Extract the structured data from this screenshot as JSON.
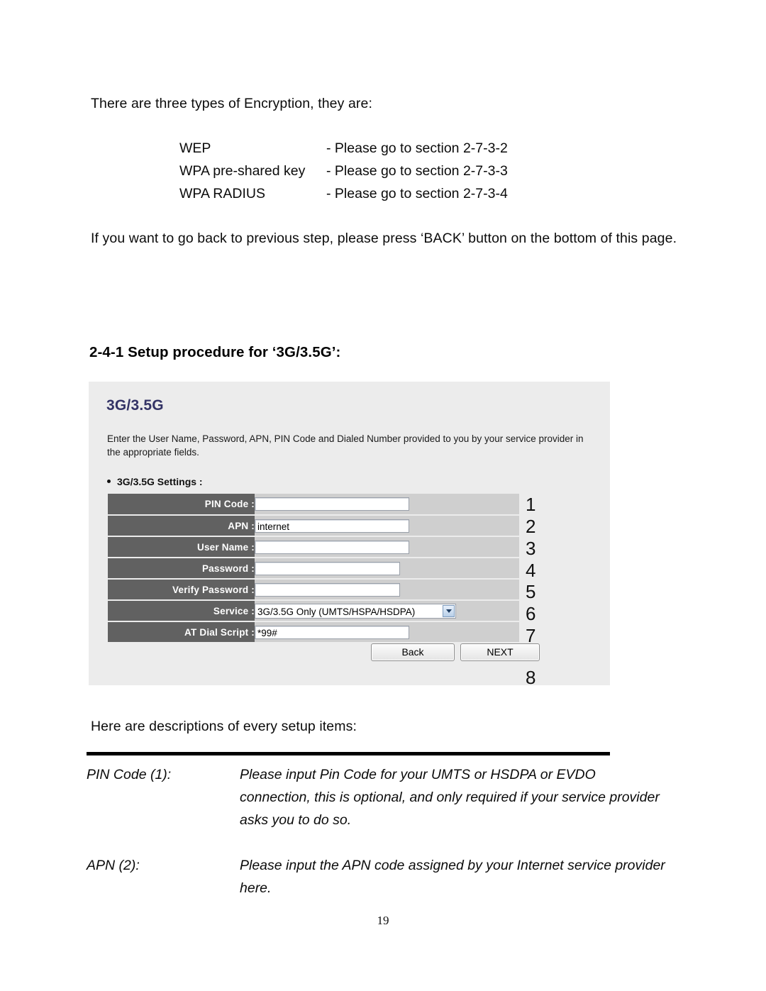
{
  "document": {
    "intro_line": "There are three types of Encryption, they are:",
    "encryption_types": [
      {
        "name": "WEP",
        "reference": "- Please go to section 2-7-3-2"
      },
      {
        "name": "WPA pre-shared key",
        "reference": "- Please go to section 2-7-3-3"
      },
      {
        "name": "WPA RADIUS",
        "reference": "- Please go to section 2-7-3-4"
      }
    ],
    "back_note": "If you want to go back to previous step, please press ‘BACK’ button on the bottom of this page.",
    "section_heading": "2-4-1 Setup procedure for ‘3G/3.5G’:",
    "descriptions_intro": "Here are descriptions of every setup items:",
    "page_number": "19"
  },
  "router_panel": {
    "title": "3G/3.5G",
    "title_color": "#333366",
    "background_color": "#ececec",
    "description": "Enter the User Name, Password, APN, PIN Code and Dialed Number provided to you by your service provider in the appropriate fields.",
    "settings_heading": "3G/3.5G Settings :",
    "fields": [
      {
        "label": "PIN Code :",
        "value": "",
        "type": "text",
        "width": "long"
      },
      {
        "label": "APN :",
        "value": "internet",
        "type": "text",
        "width": "long"
      },
      {
        "label": "User Name :",
        "value": "",
        "type": "text",
        "width": "long"
      },
      {
        "label": "Password :",
        "value": "",
        "type": "text",
        "width": "med"
      },
      {
        "label": "Verify Password :",
        "value": "",
        "type": "text",
        "width": "med"
      },
      {
        "label": "Service :",
        "value": "3G/3.5G Only (UMTS/HSPA/HSDPA)",
        "type": "select",
        "width": "sel"
      },
      {
        "label": "AT Dial Script :",
        "value": "*99#",
        "type": "text",
        "width": "long"
      }
    ],
    "buttons": {
      "back_label": "Back",
      "next_label": "NEXT"
    },
    "callouts": [
      "1",
      "2",
      "3",
      "4",
      "5",
      "6",
      "7",
      "8"
    ]
  },
  "descriptions": [
    {
      "term": "PIN Code (1):",
      "body": "Please input Pin Code for your UMTS or HSDPA or EVDO connection, this is optional, and only required if your service provider asks you to do so."
    },
    {
      "term": "APN (2):",
      "body": "Please input the APN code assigned by your Internet service provider here."
    }
  ]
}
